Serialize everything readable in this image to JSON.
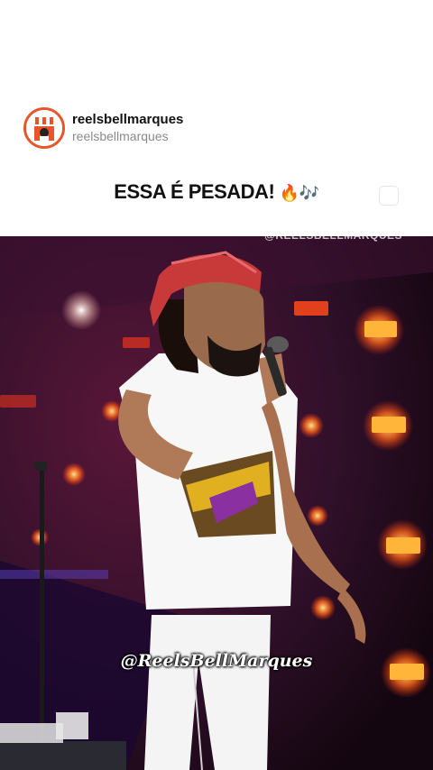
{
  "post": {
    "username": "reelsbellmarques",
    "handle": "reelsbellmarques",
    "caption": "ESSA É PESADA!",
    "caption_emoji": "🔥🎶",
    "avatar_icon": "store-mascot-icon"
  },
  "video": {
    "watermark_top": "@REELSBELLMARQUES",
    "watermark_main": "@ReelsBellMarques"
  },
  "colors": {
    "avatar_ring": "#e8552a",
    "stage_bg": "#2a0a1c",
    "stage_light": "#ff5a1f"
  }
}
